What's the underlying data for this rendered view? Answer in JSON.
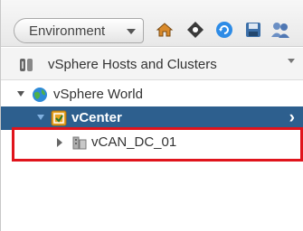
{
  "toolbar": {
    "environment_label": "Environment",
    "icons": [
      "home-icon",
      "tag-icon",
      "refresh-icon",
      "save-icon",
      "people-icon"
    ]
  },
  "navigator": {
    "title": "vSphere Hosts and Clusters"
  },
  "tree": {
    "world_label": "vSphere World",
    "vcenter_label": "vCenter",
    "datacenter_label": "vCAN_DC_01"
  },
  "colors": {
    "selected_row": "#2d5f8e",
    "highlight_border": "#e0141c"
  }
}
